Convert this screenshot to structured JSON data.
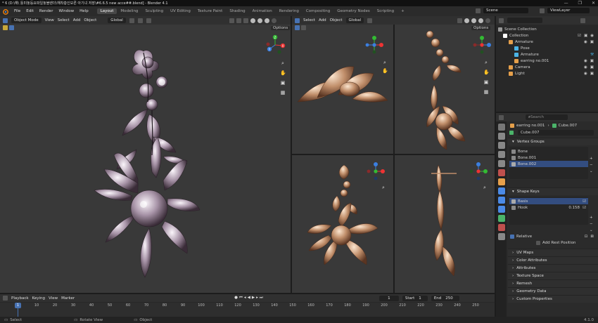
{
  "title_bar": {
    "text": "* 6 (D:\\해\\ 틀미놓등요파일놓블렌더\\해착층인모른 아기녀 저장\\#6.6.5 new acce##.blend] - Blender 4.1",
    "controls": [
      "—",
      "❐",
      "✕"
    ]
  },
  "menu": {
    "logo": "blender-logo-icon",
    "items": [
      "File",
      "Edit",
      "Render",
      "Window",
      "Help"
    ]
  },
  "workspaces": [
    "Layout",
    "Modeling",
    "Sculpting",
    "UV Editing",
    "Texture Paint",
    "Shading",
    "Animation",
    "Rendering",
    "Compositing",
    "Geometry Nodes",
    "Scripting"
  ],
  "workspace_add": "+",
  "scene_label": "Scene",
  "view_layer_label": "ViewLayer",
  "viewport_main": {
    "mode": "Object Mode",
    "menus": [
      "View",
      "Select",
      "Add",
      "Object"
    ],
    "orientation": "Global",
    "options": "Options"
  },
  "viewport_right": {
    "menus": [
      "Select",
      "Add",
      "Object"
    ],
    "orientation": "Global",
    "options": "Options"
  },
  "options_label": "Options",
  "gizmo_labels": {
    "x": "X",
    "y": "Y",
    "z": "Z"
  },
  "outliner": {
    "rows": [
      {
        "label": "Scene Collection",
        "indent": 0,
        "icon_color": "#9a9a9a"
      },
      {
        "label": "Collection",
        "indent": 1,
        "icon_color": "#ffffff"
      },
      {
        "label": "Armature",
        "indent": 2,
        "icon_color": "#e6a04b"
      },
      {
        "label": "Pose",
        "indent": 3,
        "icon_color": "#4bb4e6"
      },
      {
        "label": "Armature",
        "indent": 3,
        "icon_color": "#4bb4e6"
      },
      {
        "label": "earring no.001",
        "indent": 3,
        "icon_color": "#e6a04b"
      },
      {
        "label": "Camera",
        "indent": 2,
        "icon_color": "#e6a04b"
      },
      {
        "label": "Light",
        "indent": 2,
        "icon_color": "#e6a04b"
      }
    ]
  },
  "properties": {
    "search_placeholder": "Search",
    "breadcrumb_object": "earring no.001",
    "breadcrumb_mesh": "Cube.007",
    "mesh_name": "Cube.007",
    "vertex_groups": {
      "title": "Vertex Groups",
      "items": [
        "Bone",
        "Bone.001",
        "Bone.002"
      ],
      "selected": 2
    },
    "shape_keys": {
      "title": "Shape Keys",
      "items": [
        {
          "name": "Basis",
          "value": ""
        },
        {
          "name": "Hook",
          "value": "0.158"
        }
      ],
      "selected": 0
    },
    "relative_label": "Relative",
    "add_rest_label": "Add Rest Position",
    "panels": [
      "UV Maps",
      "Color Attributes",
      "Attributes",
      "Texture Space",
      "Remesh",
      "Geometry Data",
      "Custom Properties"
    ]
  },
  "timeline": {
    "menus": [
      "Playback",
      "Keying",
      "View",
      "Marker"
    ],
    "current_frame": "1",
    "start_label": "Start",
    "start": "1",
    "end_label": "End",
    "end": "250",
    "ticks": [
      "0",
      "10",
      "20",
      "30",
      "40",
      "50",
      "60",
      "70",
      "80",
      "90",
      "100",
      "110",
      "120",
      "130",
      "140",
      "150",
      "160",
      "170",
      "180",
      "190",
      "200",
      "210",
      "220",
      "230",
      "240",
      "250"
    ],
    "playhead": "1"
  },
  "status_bar": {
    "left": "Select",
    "middle": "Rotate View",
    "right": "Object",
    "version": "4.1.0"
  },
  "colors": {
    "accent": "#4772b3",
    "bg": "#393939",
    "header": "#303030",
    "playhead": "#4772b3"
  }
}
